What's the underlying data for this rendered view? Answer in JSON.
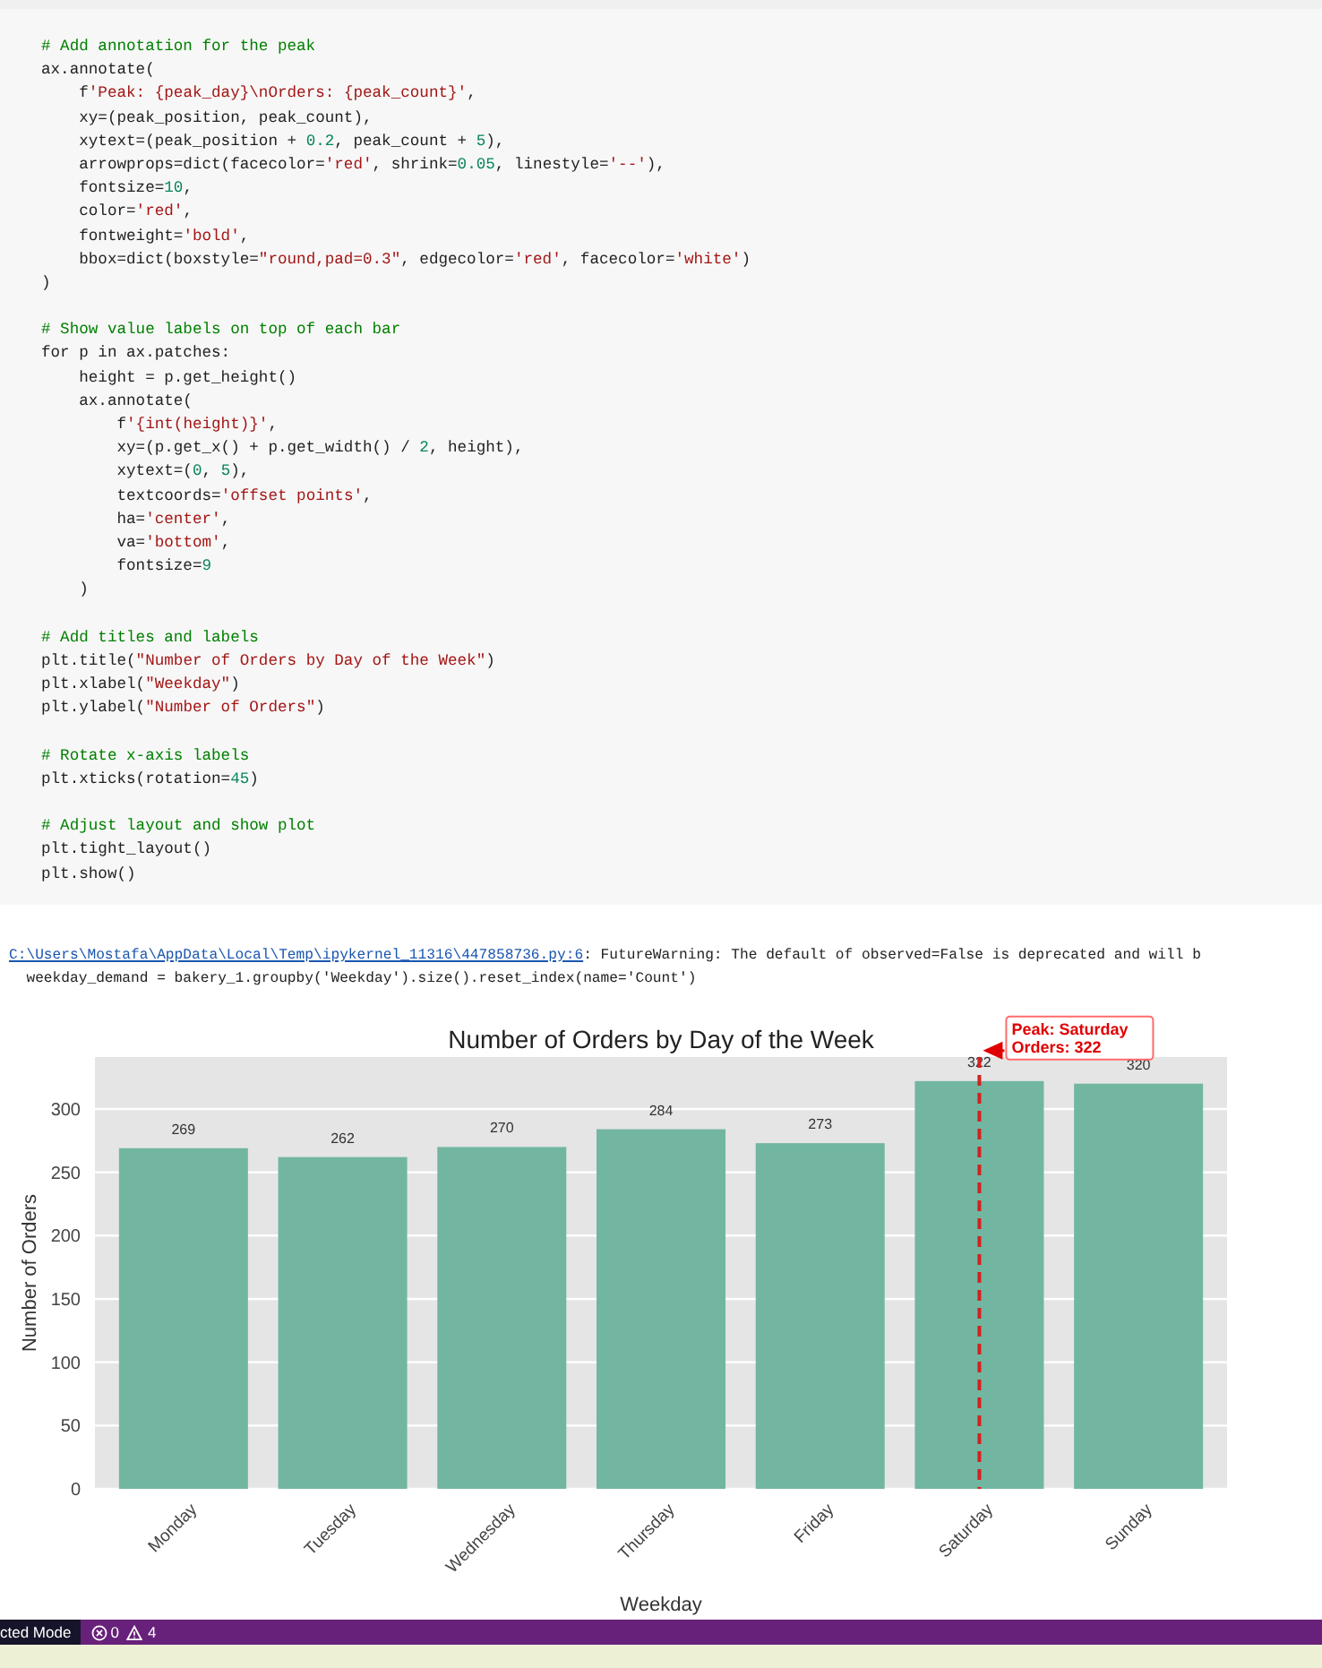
{
  "code_cell": {
    "lines": [
      {
        "kind": "comment",
        "text": "# Add annotation for the peak"
      },
      {
        "kind": "code",
        "text": "ax.annotate("
      },
      {
        "kind": "code",
        "text": "    f'Peak: {peak_day}\\nOrders: {peak_count}',"
      },
      {
        "kind": "code",
        "text": "    xy=(peak_position, peak_count),"
      },
      {
        "kind": "code",
        "text": "    xytext=(peak_position + 0.2, peak_count + 5),"
      },
      {
        "kind": "code",
        "text": "    arrowprops=dict(facecolor='red', shrink=0.05, linestyle='--'),"
      },
      {
        "kind": "code",
        "text": "    fontsize=10,"
      },
      {
        "kind": "code",
        "text": "    color='red',"
      },
      {
        "kind": "code",
        "text": "    fontweight='bold',"
      },
      {
        "kind": "code",
        "text": "    bbox=dict(boxstyle=\"round,pad=0.3\", edgecolor='red', facecolor='white')"
      },
      {
        "kind": "code",
        "text": ")"
      },
      {
        "kind": "blank"
      },
      {
        "kind": "comment",
        "text": "# Show value labels on top of each bar"
      },
      {
        "kind": "code",
        "text": "for p in ax.patches:"
      },
      {
        "kind": "code",
        "text": "    height = p.get_height()"
      },
      {
        "kind": "code",
        "text": "    ax.annotate("
      },
      {
        "kind": "code",
        "text": "        f'{int(height)}',"
      },
      {
        "kind": "code",
        "text": "        xy=(p.get_x() + p.get_width() / 2, height),"
      },
      {
        "kind": "code",
        "text": "        xytext=(0, 5),"
      },
      {
        "kind": "code",
        "text": "        textcoords='offset points',"
      },
      {
        "kind": "code",
        "text": "        ha='center',"
      },
      {
        "kind": "code",
        "text": "        va='bottom',"
      },
      {
        "kind": "code",
        "text": "        fontsize=9"
      },
      {
        "kind": "code",
        "text": "    )"
      },
      {
        "kind": "blank"
      },
      {
        "kind": "comment",
        "text": "# Add titles and labels"
      },
      {
        "kind": "code",
        "text": "plt.title(\"Number of Orders by Day of the Week\")"
      },
      {
        "kind": "code",
        "text": "plt.xlabel(\"Weekday\")"
      },
      {
        "kind": "code",
        "text": "plt.ylabel(\"Number of Orders\")"
      },
      {
        "kind": "blank"
      },
      {
        "kind": "comment",
        "text": "# Rotate x-axis labels"
      },
      {
        "kind": "code",
        "text": "plt.xticks(rotation=45)"
      },
      {
        "kind": "blank"
      },
      {
        "kind": "comment",
        "text": "# Adjust layout and show plot"
      },
      {
        "kind": "code",
        "text": "plt.tight_layout()"
      },
      {
        "kind": "code",
        "text": "plt.show()"
      }
    ]
  },
  "output": {
    "warning_link": "C:\\Users\\Mostafa\\AppData\\Local\\Temp\\ipykernel_11316\\447858736.py:6",
    "warning_text": ": FutureWarning: The default of observed=False is deprecated and will b",
    "warning_source": "  weekday_demand = bakery_1.groupby('Weekday').size().reset_index(name='Count')",
    "chart_data": {
      "type": "bar",
      "title": "Number of Orders by Day of the Week",
      "xlabel": "Weekday",
      "ylabel": "Number of Orders",
      "categories": [
        "Monday",
        "Tuesday",
        "Wednesday",
        "Thursday",
        "Friday",
        "Saturday",
        "Sunday"
      ],
      "grid": true,
      "series": [
        {
          "color": "#72b6a1",
          "values": [
            269,
            262,
            270,
            284,
            273,
            322,
            320
          ]
        }
      ],
      "ylim": [
        0,
        341
      ],
      "yticks": [
        0,
        50,
        100,
        150,
        200,
        250,
        300
      ],
      "data_labels": true,
      "annotations": [
        {
          "text": "Peak: Saturday\nOrders: 322",
          "x": "Saturday",
          "y": 322
        }
      ]
    }
  },
  "status_bar": {
    "mode": "cted Mode",
    "errors": "0",
    "warnings": "4"
  }
}
